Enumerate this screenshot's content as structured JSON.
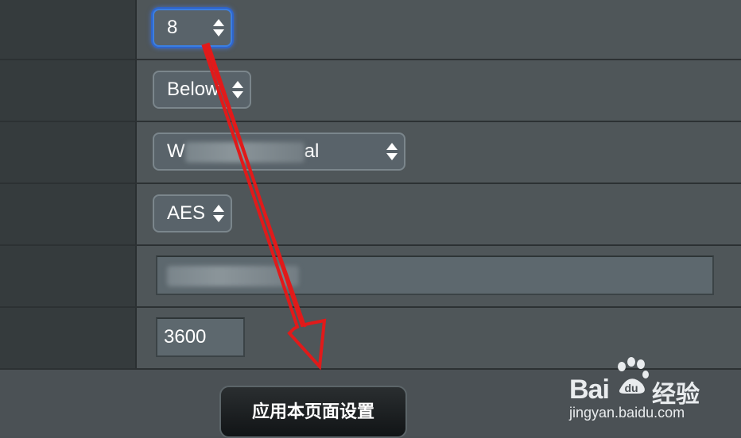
{
  "settings": {
    "channel": {
      "value": "8"
    },
    "extension_channel": {
      "value": "Below"
    },
    "authentication": {
      "value_start": "W",
      "value_end": "al"
    },
    "encryption": {
      "value": "AES"
    },
    "key": {
      "value": ""
    },
    "rekey_interval": {
      "value": "3600"
    }
  },
  "actions": {
    "apply_label": "应用本页面设置"
  },
  "watermark": {
    "logo": "Bai",
    "logo_cn": "经验",
    "url": "jingyan.baidu.com"
  },
  "colors": {
    "focus": "#3c7fe0",
    "arrow": "#e11a1a",
    "panel": "#4f5659",
    "label_col": "#353b3d"
  },
  "icons": {
    "select": "up-down-arrows-icon",
    "annotation": "red-arrow-annotation"
  }
}
